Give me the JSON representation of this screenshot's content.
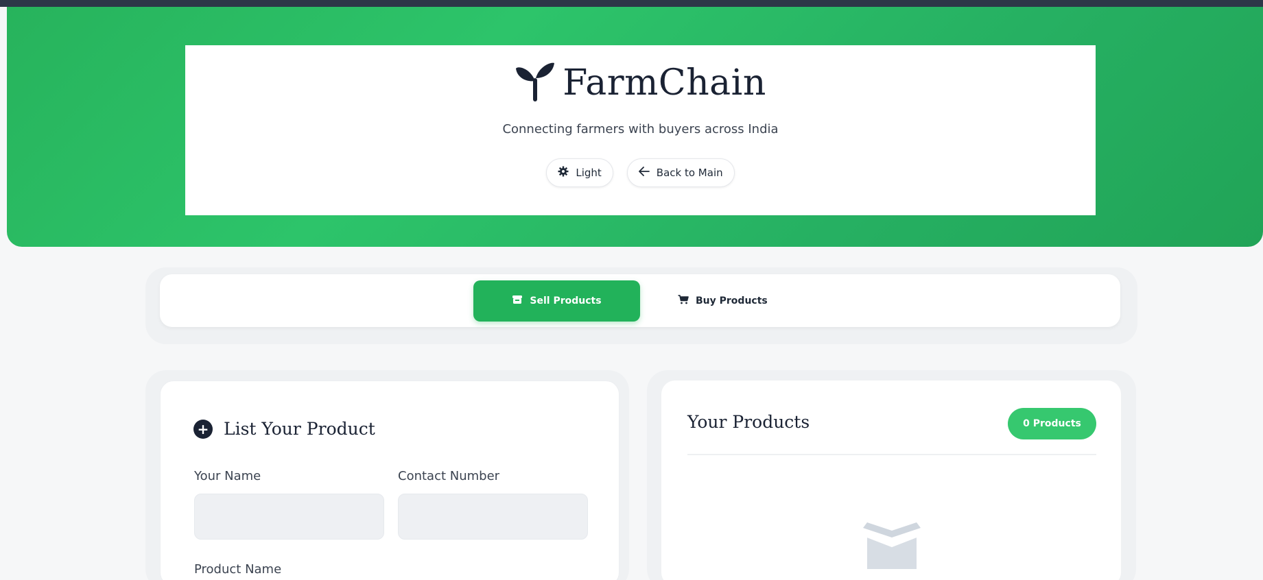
{
  "brand": {
    "title": "FarmChain",
    "tagline": "Connecting farmers with buyers across India",
    "icon": "sprout-icon"
  },
  "header_buttons": {
    "theme_label": "Light",
    "theme_icon": "gear-icon",
    "back_label": "Back to Main",
    "back_icon": "arrow-left-icon"
  },
  "tabs": [
    {
      "label": "Sell Products",
      "icon": "store-icon",
      "active": true
    },
    {
      "label": "Buy Products",
      "icon": "cart-icon",
      "active": false
    }
  ],
  "list_form": {
    "title": "List Your Product",
    "icon": "plus-circle-icon",
    "fields": {
      "name_label": "Your Name",
      "name_value": "",
      "contact_label": "Contact Number",
      "contact_value": "",
      "product_label": "Product Name"
    }
  },
  "your_products": {
    "title": "Your Products",
    "count_badge": "0 Products",
    "empty_icon": "empty-box-icon"
  },
  "colors": {
    "accent_green": "#22b25a",
    "hero_green": "#2dc46a",
    "badge_green": "#36c86f",
    "dark_text": "#1a2233"
  }
}
